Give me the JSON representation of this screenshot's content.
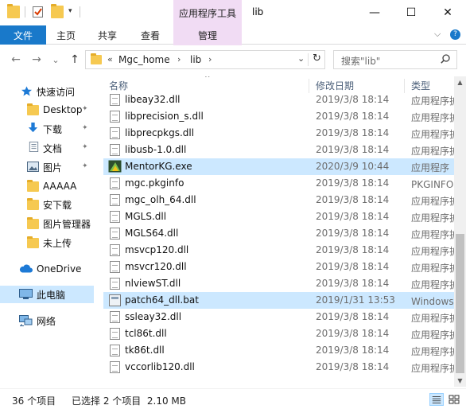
{
  "window": {
    "title": "lib",
    "context_tab_header": "应用程序工具",
    "minimize": "—",
    "maximize": "☐",
    "close": "✕"
  },
  "ribbon": {
    "tabs": [
      {
        "label": "文件"
      },
      {
        "label": "主页"
      },
      {
        "label": "共享"
      },
      {
        "label": "查看"
      },
      {
        "label": "管理"
      }
    ],
    "collapse_glyph": "⌵",
    "help_glyph": "?"
  },
  "nav": {
    "back": "←",
    "forward": "→",
    "recent": "⌄",
    "up": "↑",
    "breadcrumb_prefix": "«",
    "breadcrumb": [
      "Mgc_home",
      "lib"
    ],
    "breadcrumb_sep": "›",
    "refresh": "↻",
    "search_placeholder": "搜索\"lib\"",
    "dropdown": "⌄"
  },
  "sidebar": {
    "quick_access": "快速访问",
    "items": [
      {
        "label": "Desktop",
        "pinned": true
      },
      {
        "label": "下载",
        "pinned": true
      },
      {
        "label": "文档",
        "pinned": true
      },
      {
        "label": "图片",
        "pinned": true
      },
      {
        "label": "AAAAA",
        "pinned": false
      },
      {
        "label": "安下载",
        "pinned": false
      },
      {
        "label": "图片管理器",
        "pinned": false
      },
      {
        "label": "未上传",
        "pinned": false
      }
    ],
    "onedrive": "OneDrive",
    "this_pc": "此电脑",
    "network": "网络",
    "pin_glyph": "✦"
  },
  "columns": {
    "name": "名称",
    "date": "修改日期",
    "type": "类型",
    "sort_glyph": "^"
  },
  "files": [
    {
      "name": "libeay32.dll",
      "date": "2019/3/8 18:14",
      "type": "应用程序扩展",
      "kind": "dll",
      "selected": false
    },
    {
      "name": "libprecision_s.dll",
      "date": "2019/3/8 18:14",
      "type": "应用程序扩展",
      "kind": "dll",
      "selected": false
    },
    {
      "name": "libprecpkgs.dll",
      "date": "2019/3/8 18:14",
      "type": "应用程序扩展",
      "kind": "dll",
      "selected": false
    },
    {
      "name": "libusb-1.0.dll",
      "date": "2019/3/8 18:14",
      "type": "应用程序扩展",
      "kind": "dll",
      "selected": false
    },
    {
      "name": "MentorKG.exe",
      "date": "2020/3/9 10:44",
      "type": "应用程序",
      "kind": "exe",
      "selected": true
    },
    {
      "name": "mgc.pkginfo",
      "date": "2019/3/8 18:14",
      "type": "PKGINFO 文件",
      "kind": "file",
      "selected": false
    },
    {
      "name": "mgc_olh_64.dll",
      "date": "2019/3/8 18:14",
      "type": "应用程序扩展",
      "kind": "dll",
      "selected": false
    },
    {
      "name": "MGLS.dll",
      "date": "2019/3/8 18:14",
      "type": "应用程序扩展",
      "kind": "dll",
      "selected": false
    },
    {
      "name": "MGLS64.dll",
      "date": "2019/3/8 18:14",
      "type": "应用程序扩展",
      "kind": "dll",
      "selected": false
    },
    {
      "name": "msvcp120.dll",
      "date": "2019/3/8 18:14",
      "type": "应用程序扩展",
      "kind": "dll",
      "selected": false
    },
    {
      "name": "msvcr120.dll",
      "date": "2019/3/8 18:14",
      "type": "应用程序扩展",
      "kind": "dll",
      "selected": false
    },
    {
      "name": "nlviewST.dll",
      "date": "2019/3/8 18:14",
      "type": "应用程序扩展",
      "kind": "dll",
      "selected": false
    },
    {
      "name": "patch64_dll.bat",
      "date": "2019/1/31 13:53",
      "type": "Windows 批处理文件",
      "kind": "bat",
      "selected": true
    },
    {
      "name": "ssleay32.dll",
      "date": "2019/3/8 18:14",
      "type": "应用程序扩展",
      "kind": "dll",
      "selected": false
    },
    {
      "name": "tcl86t.dll",
      "date": "2019/3/8 18:14",
      "type": "应用程序扩展",
      "kind": "dll",
      "selected": false
    },
    {
      "name": "tk86t.dll",
      "date": "2019/3/8 18:14",
      "type": "应用程序扩展",
      "kind": "dll",
      "selected": false
    },
    {
      "name": "vccorlib120.dll",
      "date": "2019/3/8 18:14",
      "type": "应用程序扩展",
      "kind": "dll",
      "selected": false
    }
  ],
  "scrollbar": {
    "up": "▲",
    "down": "▼"
  },
  "status": {
    "count": "36 个项目",
    "selection": "已选择 2 个项目  2.10 MB"
  },
  "colors": {
    "accent": "#1979ca",
    "context_tab": "#f1dcf4",
    "selection": "#cce8ff",
    "folder": "#f6c951"
  }
}
